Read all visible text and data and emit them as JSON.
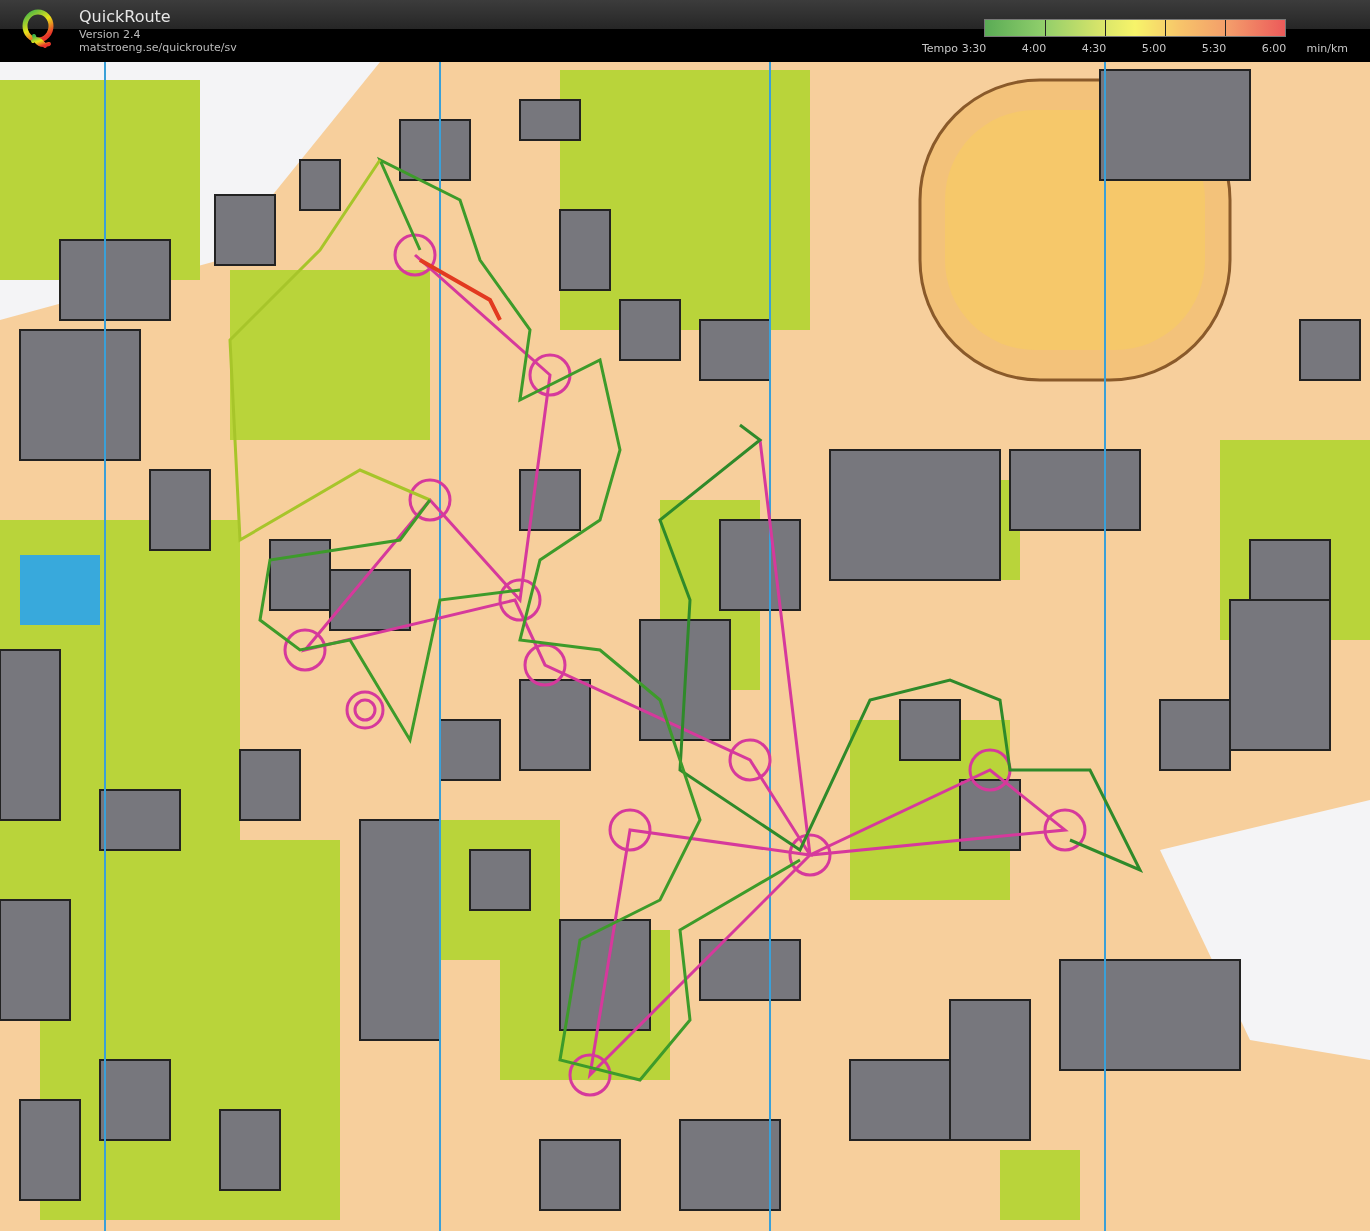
{
  "app": {
    "title": "QuickRoute",
    "version": "Version 2.4",
    "url": "matstroeng.se/quickroute/sv"
  },
  "legend": {
    "label": "Tempo",
    "ticks": [
      "3:30",
      "4:00",
      "4:30",
      "5:00",
      "5:30",
      "6:00"
    ],
    "unit": "min/km"
  }
}
